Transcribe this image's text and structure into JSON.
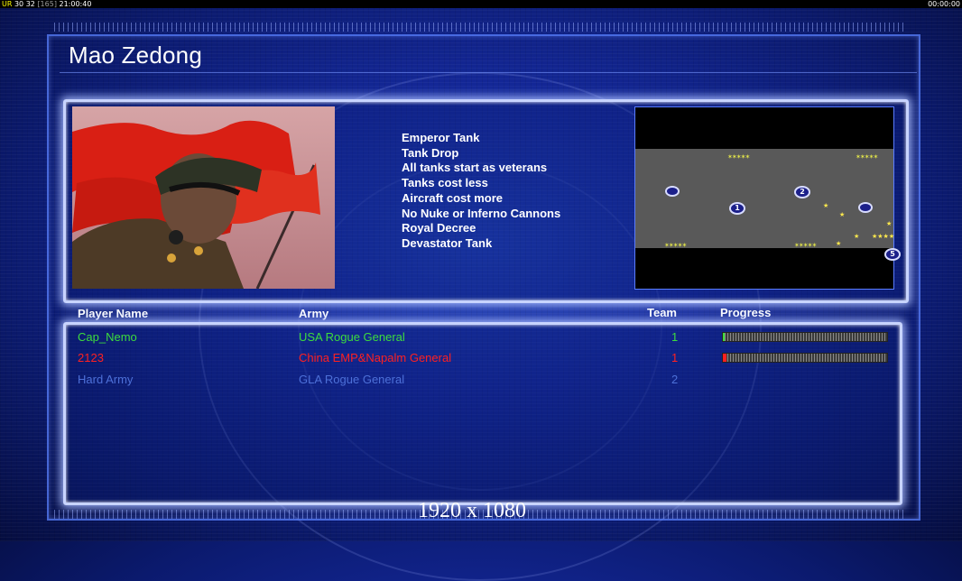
{
  "hud": {
    "left_parts": [
      "UR",
      "30",
      "32",
      "[165]",
      "21:00:40"
    ],
    "right_clock": "00:00:00"
  },
  "general_name": "Mao Zedong",
  "features": [
    "Emperor Tank",
    "Tank Drop",
    "All tanks start as veterans",
    "Tanks cost less",
    "Aircraft cost more",
    "No Nuke or Inferno Cannons",
    "Royal Decree",
    "Devastator Tank"
  ],
  "map": {
    "start_labels": [
      "1",
      "2",
      "5"
    ]
  },
  "columns": {
    "player_name": "Player Name",
    "army": "Army",
    "team": "Team",
    "progress": "Progress"
  },
  "players": [
    {
      "name": "Cap_Nemo",
      "army": "USA Rogue General",
      "team": "1",
      "color": "#3ddc3d",
      "progress": 0.01
    },
    {
      "name": "2123",
      "army": "China EMP&Napalm General",
      "team": "1",
      "color": "#ff2020",
      "progress": 0.02
    },
    {
      "name": "Hard Army",
      "army": "GLA Rogue General",
      "team": "2",
      "color": "#4d70d8",
      "progress": null
    }
  ],
  "resolution": "1920 x 1080"
}
